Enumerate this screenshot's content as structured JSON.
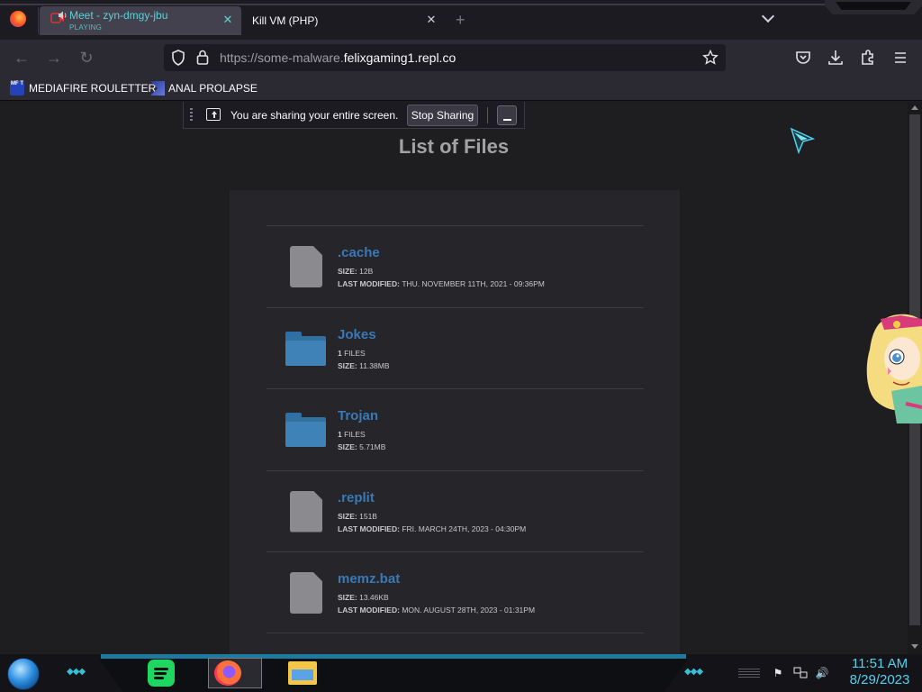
{
  "browser": {
    "tabs": [
      {
        "title": "Meet - zyn-dmgy-jbu",
        "status": "PLAYING",
        "active": true
      },
      {
        "title": "Kill VM (PHP)",
        "active": false
      }
    ],
    "url": {
      "prefix": "https://some-malware.",
      "domain": "felixgaming1.repl.co"
    },
    "bookmarks": [
      {
        "label": "MEDIAFIRE ROULETTER",
        "favicon_text": "MF T"
      },
      {
        "label": "ANAL PROLAPSE"
      }
    ]
  },
  "sharing_bar": {
    "message": "You are sharing your entire screen.",
    "stop_label": "Stop Sharing"
  },
  "page": {
    "title": "List of Files",
    "files": [
      {
        "name": ".cache",
        "type": "file",
        "size_label": "SIZE:",
        "size": "12B",
        "modified_label": "LAST MODIFIED:",
        "modified": "THU. NOVEMBER 11TH, 2021 - 09:36PM"
      },
      {
        "name": "Jokes",
        "type": "folder",
        "files": "FILES",
        "count": "1",
        "size_label": "SIZE:",
        "size": "11.38MB"
      },
      {
        "name": "Trojan",
        "type": "folder",
        "files": "FILES",
        "count": "1",
        "size_label": "SIZE:",
        "size": "5.71MB"
      },
      {
        "name": ".replit",
        "type": "file",
        "size_label": "SIZE:",
        "size": "151B",
        "modified_label": "LAST MODIFIED:",
        "modified": "FRI. MARCH 24TH, 2023 - 04:30PM"
      },
      {
        "name": "memz.bat",
        "type": "file",
        "size_label": "SIZE:",
        "size": "13.46KB",
        "modified_label": "LAST MODIFIED:",
        "modified": "MON. AUGUST 28TH, 2023 - 01:31PM"
      }
    ]
  },
  "taskbar": {
    "time": "11:51 AM",
    "date": "8/29/2023"
  },
  "colors": {
    "folder_name": "#3a79b8",
    "clock": "#4fd2f0",
    "accent_band": "#1e7aa0"
  }
}
